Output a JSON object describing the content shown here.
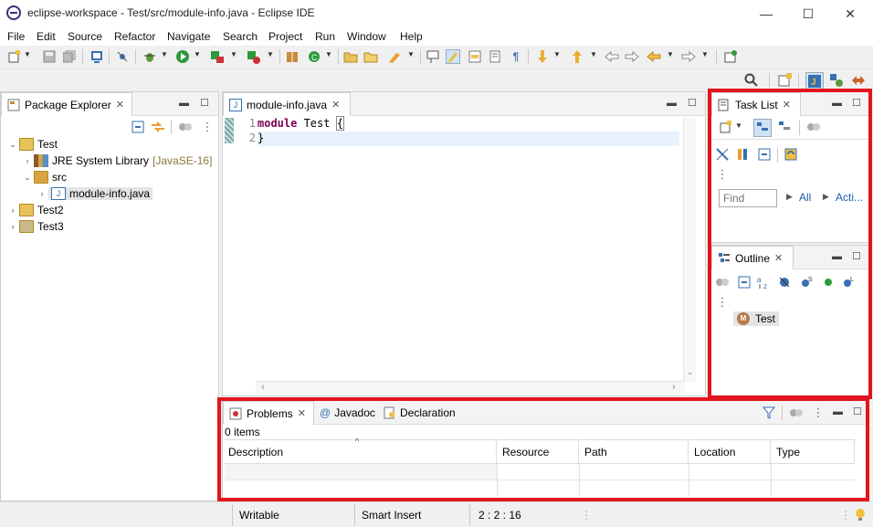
{
  "window": {
    "title": "eclipse-workspace - Test/src/module-info.java - Eclipse IDE",
    "minimize": "—",
    "maximize": "☐",
    "close": "✕"
  },
  "menu": [
    "File",
    "Edit",
    "Source",
    "Refactor",
    "Navigate",
    "Search",
    "Project",
    "Run",
    "Window",
    "Help"
  ],
  "package_explorer": {
    "tab_label": "Package Explorer",
    "tree": [
      {
        "label": "Test",
        "level": 0,
        "expanded": true
      },
      {
        "label": "JRE System Library",
        "decoration": "[JavaSE-16]",
        "level": 1,
        "expanded": false
      },
      {
        "label": "src",
        "level": 1,
        "expanded": true
      },
      {
        "label": "module-info.java",
        "level": 2,
        "expanded": false
      },
      {
        "label": "Test2",
        "level": 0,
        "expanded": false
      },
      {
        "label": "Test3",
        "level": 0,
        "expanded": false
      }
    ]
  },
  "editor": {
    "tab_label": "module-info.java",
    "lines": [
      {
        "num": "1",
        "keyword": "module",
        "rest": " Test ",
        "brace": "{"
      },
      {
        "num": "2",
        "keyword": "",
        "rest": "}",
        "brace": ""
      }
    ]
  },
  "task_list": {
    "tab_label": "Task List",
    "find_placeholder": "Find",
    "all_label": "All",
    "acti_label": "Acti..."
  },
  "outline": {
    "tab_label": "Outline",
    "items": [
      "Test"
    ]
  },
  "bottom": {
    "tabs": [
      "Problems",
      "Javadoc",
      "Declaration"
    ],
    "item_count": "0 items",
    "columns": [
      "Description",
      "Resource",
      "Path",
      "Location",
      "Type"
    ]
  },
  "status": {
    "writable": "Writable",
    "insert_mode": "Smart Insert",
    "position": "2 : 2 : 16"
  },
  "colors": {
    "highlight_box": "#e3141e",
    "keyword": "#7f0055"
  }
}
